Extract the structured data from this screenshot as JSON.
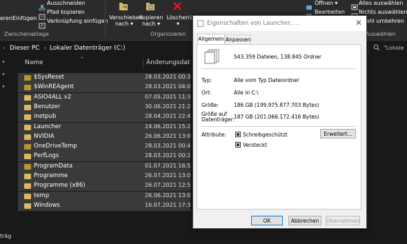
{
  "colors": {
    "folder": "#dcb862",
    "folder_dark": "#b8962e",
    "accent": "#0078d7",
    "delete_red": "#e81123"
  },
  "ribbon": {
    "paste_label_partial": "eren",
    "einfuegen": "Einfügen",
    "ausschneiden": "Ausschneiden",
    "pfad_kopieren": "Pfad kopieren",
    "verknuepfung": "Verknüpfung einfügen",
    "group_zwischenablage": "Zwischenablage",
    "verschieben_1": "Verschieben",
    "verschieben_2": "nach",
    "kopieren_1": "Kopieren",
    "kopieren_2": "nach",
    "loeschen": "Löschen",
    "umbenennen_partial": "Um",
    "group_organisieren": "Organisieren",
    "oeffnen": "Öffnen",
    "bearbeiten": "Bearbeiten",
    "alles_auswaehlen": "Alles auswählen",
    "nichts_auswaehlen": "Nichts auswählen",
    "auswahl_umkehren": "swahl umkehren",
    "group_auswaehlen": "Auswählen"
  },
  "address": {
    "crumb1": "Dieser PC",
    "crumb2": "Lokaler Datenträger (C:)",
    "search_placeholder": "\"Lokale"
  },
  "nav": {
    "bottom_label": "träg"
  },
  "list": {
    "col_name": "Name",
    "col_date": "Änderungsdatum",
    "rows": [
      {
        "name": "$SysReset",
        "date": "28.03.2021 00:35",
        "dim": true
      },
      {
        "name": "$WinREAgent",
        "date": "28.03.2021 04:05",
        "dim": true
      },
      {
        "name": "ASIO4ALL v2",
        "date": "07.05.2021 11:30",
        "dim": false
      },
      {
        "name": "Benutzer",
        "date": "30.06.2021 21:23",
        "dim": false
      },
      {
        "name": "inetpub",
        "date": "28.04.2021 22:40",
        "dim": false
      },
      {
        "name": "Launcher",
        "date": "24.06.2021 15:21",
        "dim": false
      },
      {
        "name": "NVIDIA",
        "date": "26.06.2021 13:01",
        "dim": false
      },
      {
        "name": "OneDriveTemp",
        "date": "28.03.2021 00:48",
        "dim": true
      },
      {
        "name": "PerfLogs",
        "date": "28.03.2021 00:29",
        "dim": false
      },
      {
        "name": "ProgramData",
        "date": "01.07.2021 16:52",
        "dim": true
      },
      {
        "name": "Programme",
        "date": "26.07.2021 13:00",
        "dim": false
      },
      {
        "name": "Programme (x86)",
        "date": "26.07.2021 12:57",
        "dim": false
      },
      {
        "name": "temp",
        "date": "26.06.2021 13:03",
        "dim": false
      },
      {
        "name": "Windows",
        "date": "16.07.2021 17:36",
        "dim": false
      }
    ]
  },
  "dialog": {
    "title": "Eigenschaften von Launcher, ...",
    "tab_general": "Allgemein",
    "tab_customize": "Anpassen",
    "summary": "543.359 Dateien, 138.845 Ordner",
    "typ_label": "Typ:",
    "typ_value": "Alle vom Typ Dateiordner",
    "ort_label": "Ort:",
    "ort_value": "Alle in C:\\",
    "groesse_label": "Größe:",
    "groesse_value": "186 GB (199.975.877.703 Bytes)",
    "groesse_auf_1": "Größe auf",
    "groesse_auf_2": "Datenträger:",
    "groesse_auf_value": "187 GB (201.066.172.416 Bytes)",
    "attribute_label": "Attribute:",
    "schreibgeschuetzt": "Schreibgeschützt",
    "versteckt": "Versteckt",
    "erweitert": "Erweitert...",
    "ok": "OK",
    "abbrechen": "Abbrechen",
    "uebernehmen": "Übernehmen"
  }
}
